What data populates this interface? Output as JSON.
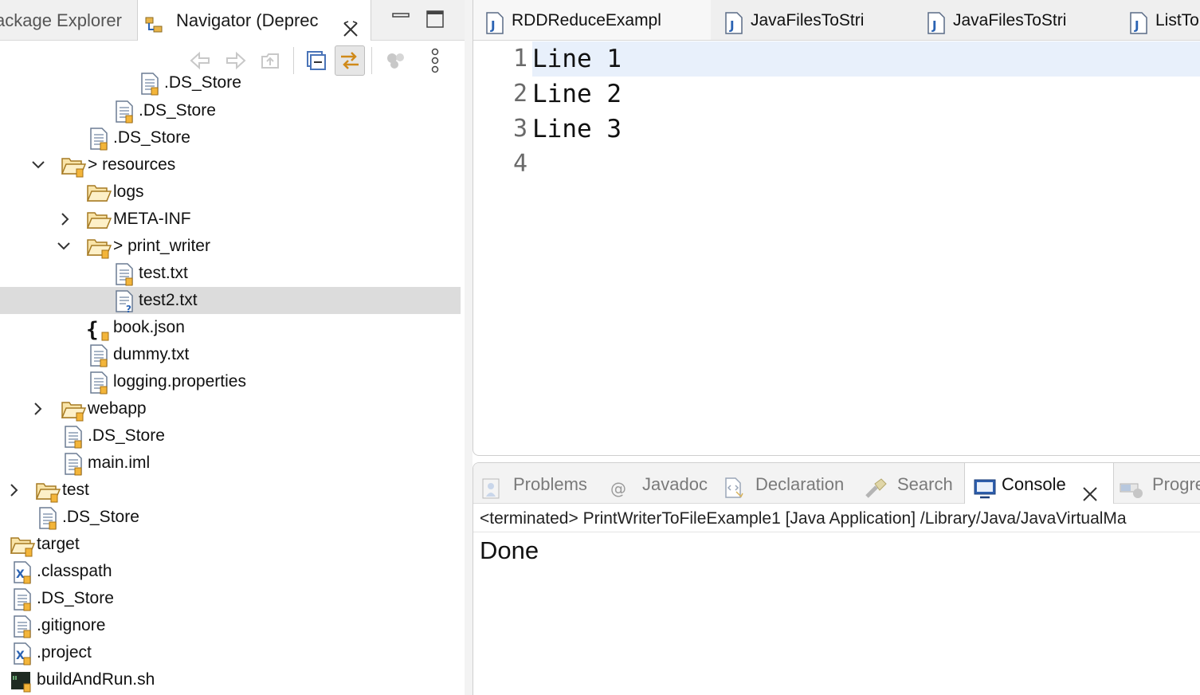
{
  "left_panel": {
    "tabs": {
      "package_explorer": "ackage Explorer",
      "navigator": "Navigator (Deprec"
    },
    "tree": [
      {
        "label": ".DS_Store",
        "icon": "text-file-icon",
        "expander": "none"
      },
      {
        "label": ".DS_Store",
        "icon": "text-file-icon",
        "expander": "none"
      },
      {
        "label": ".DS_Store",
        "icon": "text-file-icon",
        "expander": "none"
      },
      {
        "label": "> resources",
        "icon": "folder-open-icon",
        "expander": "expanded"
      },
      {
        "label": "logs",
        "icon": "folder-icon",
        "expander": "none"
      },
      {
        "label": "META-INF",
        "icon": "folder-icon",
        "expander": "collapsed"
      },
      {
        "label": "> print_writer",
        "icon": "folder-open-icon",
        "expander": "expanded"
      },
      {
        "label": "test.txt",
        "icon": "text-file-icon",
        "expander": "none"
      },
      {
        "label": "test2.txt",
        "icon": "text-file-unknown-icon",
        "expander": "none",
        "selected": true
      },
      {
        "label": "book.json",
        "icon": "json-file-icon",
        "expander": "none"
      },
      {
        "label": "dummy.txt",
        "icon": "text-file-icon",
        "expander": "none"
      },
      {
        "label": "logging.properties",
        "icon": "text-file-icon",
        "expander": "none"
      },
      {
        "label": "webapp",
        "icon": "folder-open-icon",
        "expander": "collapsed"
      },
      {
        "label": ".DS_Store",
        "icon": "text-file-icon",
        "expander": "none"
      },
      {
        "label": "main.iml",
        "icon": "text-file-icon",
        "expander": "none"
      },
      {
        "label": "test",
        "icon": "folder-open-icon",
        "expander": "collapsed"
      },
      {
        "label": ".DS_Store",
        "icon": "text-file-icon",
        "expander": "none"
      },
      {
        "label": "target",
        "icon": "folder-open-icon",
        "expander": "none"
      },
      {
        "label": ".classpath",
        "icon": "xml-file-icon",
        "expander": "none"
      },
      {
        "label": ".DS_Store",
        "icon": "text-file-icon",
        "expander": "none"
      },
      {
        "label": ".gitignore",
        "icon": "text-file-icon",
        "expander": "none"
      },
      {
        "label": ".project",
        "icon": "xml-file-icon",
        "expander": "none"
      },
      {
        "label": "buildAndRun.sh",
        "icon": "shell-script-icon",
        "expander": "none"
      }
    ]
  },
  "editor": {
    "tabs": [
      {
        "label": "RDDReduceExampl",
        "icon": "java-file-icon"
      },
      {
        "label": "JavaFilesToStri",
        "icon": "java-file-icon"
      },
      {
        "label": "JavaFilesToStri",
        "icon": "java-file-icon"
      },
      {
        "label": "ListTo",
        "icon": "java-file-icon"
      }
    ],
    "lines": [
      {
        "number": "1",
        "text": "Line 1"
      },
      {
        "number": "2",
        "text": "Line 2"
      },
      {
        "number": "3",
        "text": "Line 3"
      },
      {
        "number": "4",
        "text": ""
      }
    ]
  },
  "console": {
    "tabs": [
      {
        "label": "Problems",
        "icon": "problems-icon"
      },
      {
        "label": "Javadoc",
        "icon": "at-icon"
      },
      {
        "label": "Declaration",
        "icon": "declaration-icon"
      },
      {
        "label": "Search",
        "icon": "search-flashlight-icon"
      },
      {
        "label": "Console",
        "icon": "console-icon",
        "active": true
      },
      {
        "label": "Progre",
        "icon": "progress-icon"
      }
    ],
    "status": "<terminated> PrintWriterToFileExample1 [Java Application] /Library/Java/JavaVirtualMa",
    "output": "Done"
  },
  "colors": {
    "selection": "#dcdcdc",
    "current_line": "#e8f0fb",
    "folder": "#e8b44a",
    "java_icon": "#2b63b3",
    "active_toggle": "#d08a1a"
  }
}
